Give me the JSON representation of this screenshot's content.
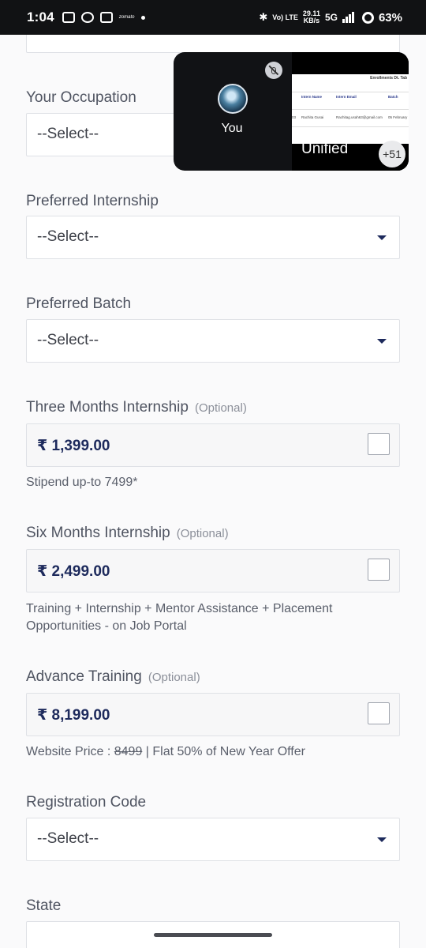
{
  "status_bar": {
    "time": "1:04",
    "app_icons": [
      "video-icon",
      "chat-icon",
      "discord-icon",
      "zomato"
    ],
    "zomato_label": "zomato",
    "net_top": "Vo) LTE",
    "net_speed": "29.11",
    "net_unit": "KB/s",
    "network": "5G",
    "battery": "63%"
  },
  "meeting": {
    "self_label": "You",
    "shared_title": "Enrollments Dt. Tab",
    "shared_headers": [
      "",
      "Intern Name",
      "Intern Email",
      "Batch"
    ],
    "shared_row": [
      "03",
      "Rachita Gusai",
      "Rachitag.usah63@gmail.com",
      "05 February"
    ],
    "shared_caption": "Unified",
    "more_count": "+51"
  },
  "form": {
    "occupation": {
      "label": "Your Occupation",
      "value": "--Select--"
    },
    "internship": {
      "label": "Preferred Internship",
      "value": "--Select--"
    },
    "batch": {
      "label": "Preferred Batch",
      "value": "--Select--"
    },
    "three_months": {
      "label": "Three Months Internship",
      "optional": "(Optional)",
      "price": "₹ 1,399.00",
      "note": "Stipend up-to 7499*",
      "checked": false
    },
    "six_months": {
      "label": "Six Months Internship",
      "optional": "(Optional)",
      "price": "₹ 2,499.00",
      "note": "Training + Internship + Mentor Assistance + Placement Opportunities - on Job Portal",
      "checked": false
    },
    "advance": {
      "label": "Advance Training",
      "optional": "(Optional)",
      "price": "₹ 8,199.00",
      "note_prefix": "Website Price : ",
      "note_strike": "8499",
      "note_suffix": " | Flat 50% of New Year Offer",
      "checked": false
    },
    "registration": {
      "label": "Registration Code",
      "value": "--Select--"
    },
    "state": {
      "label": "State"
    }
  }
}
